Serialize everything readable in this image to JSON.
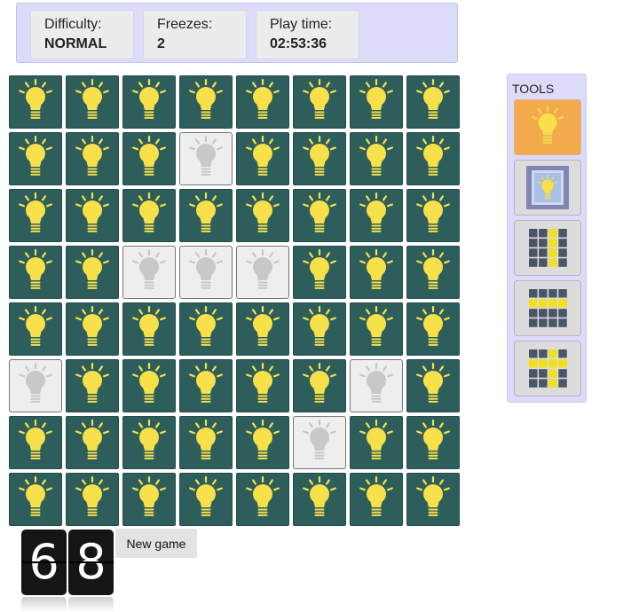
{
  "stats": {
    "difficulty_label": "Difficulty:",
    "difficulty_value": "NORMAL",
    "freezes_label": "Freezes:",
    "freezes_value": "2",
    "playtime_label": "Play time:",
    "playtime_value": "02:53:36"
  },
  "board": {
    "rows": 8,
    "cols": 8,
    "grid": [
      [
        1,
        1,
        1,
        1,
        1,
        1,
        1,
        1
      ],
      [
        1,
        1,
        1,
        0,
        1,
        1,
        1,
        1
      ],
      [
        1,
        1,
        1,
        1,
        1,
        1,
        1,
        1
      ],
      [
        1,
        1,
        0,
        0,
        0,
        1,
        1,
        1
      ],
      [
        1,
        1,
        1,
        1,
        1,
        1,
        1,
        1
      ],
      [
        0,
        1,
        1,
        1,
        1,
        1,
        0,
        1
      ],
      [
        1,
        1,
        1,
        1,
        1,
        0,
        1,
        1
      ],
      [
        1,
        1,
        1,
        1,
        1,
        1,
        1,
        1
      ]
    ]
  },
  "tools": {
    "title": "TOOLS",
    "items": [
      {
        "name": "single-bulb-tool",
        "active": true
      },
      {
        "name": "frame-bulb-tool",
        "active": false
      },
      {
        "name": "column-tool",
        "active": false
      },
      {
        "name": "row-tool",
        "active": false
      },
      {
        "name": "cross-tool",
        "active": false
      }
    ]
  },
  "counter": {
    "digits": [
      "6",
      "8"
    ]
  },
  "new_game_label": "New game",
  "colors": {
    "lit_tile": "#2d5e5c",
    "bulb_on": "#f7e04a",
    "unlit_tile": "#eeeeee",
    "bulb_off": "#c8c8c8",
    "panel": "#dcdcfa",
    "active_tool": "#f2aa4c",
    "tool_highlight": "#f0e020",
    "tool_cell": "#4b5568"
  }
}
